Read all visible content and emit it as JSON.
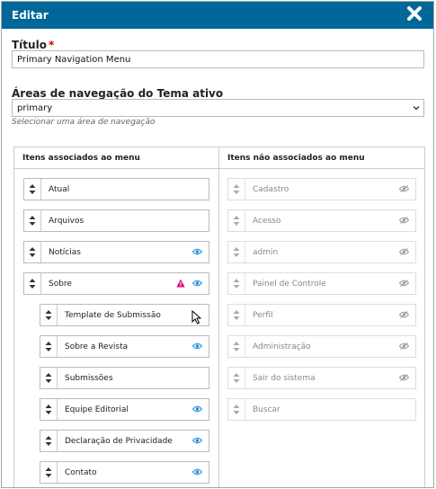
{
  "dialog": {
    "title": "Editar"
  },
  "form": {
    "title_label": "Título",
    "required_mark": "*",
    "title_value": "Primary Navigation Menu",
    "area_label": "Áreas de navegação do Tema ativo",
    "area_value": "primary",
    "area_help": "Selecionar uma área de navegação"
  },
  "assigned": {
    "heading": "Itens associados ao menu",
    "items": [
      {
        "label": "Atual",
        "eye": false,
        "warn": false
      },
      {
        "label": "Arquivos",
        "eye": false,
        "warn": false
      },
      {
        "label": "Notícias",
        "eye": true,
        "warn": false
      },
      {
        "label": "Sobre",
        "eye": true,
        "warn": true
      },
      {
        "label": "Template de Submissão",
        "eye": false,
        "warn": false
      },
      {
        "label": "Sobre a Revista",
        "eye": true,
        "warn": false
      },
      {
        "label": "Submissões",
        "eye": false,
        "warn": false
      },
      {
        "label": "Equipe Editorial",
        "eye": true,
        "warn": false
      },
      {
        "label": "Declaração de Privacidade",
        "eye": true,
        "warn": false
      },
      {
        "label": "Contato",
        "eye": true,
        "warn": false
      }
    ]
  },
  "unassigned": {
    "heading": "Itens não associados ao menu",
    "items": [
      {
        "label": "Cadastro",
        "eye": true
      },
      {
        "label": "Acesso",
        "eye": true
      },
      {
        "label": "admin",
        "eye": true
      },
      {
        "label": "Painel de Controle",
        "eye": true
      },
      {
        "label": "Perfil",
        "eye": true
      },
      {
        "label": "Administração",
        "eye": true
      },
      {
        "label": "Sair do sistema",
        "eye": true
      },
      {
        "label": "Buscar",
        "eye": false
      }
    ]
  },
  "colors": {
    "header": "#006798",
    "eye_active": "#1a8fd1",
    "eye_inactive": "#999999",
    "warning": "#d00a6c"
  }
}
